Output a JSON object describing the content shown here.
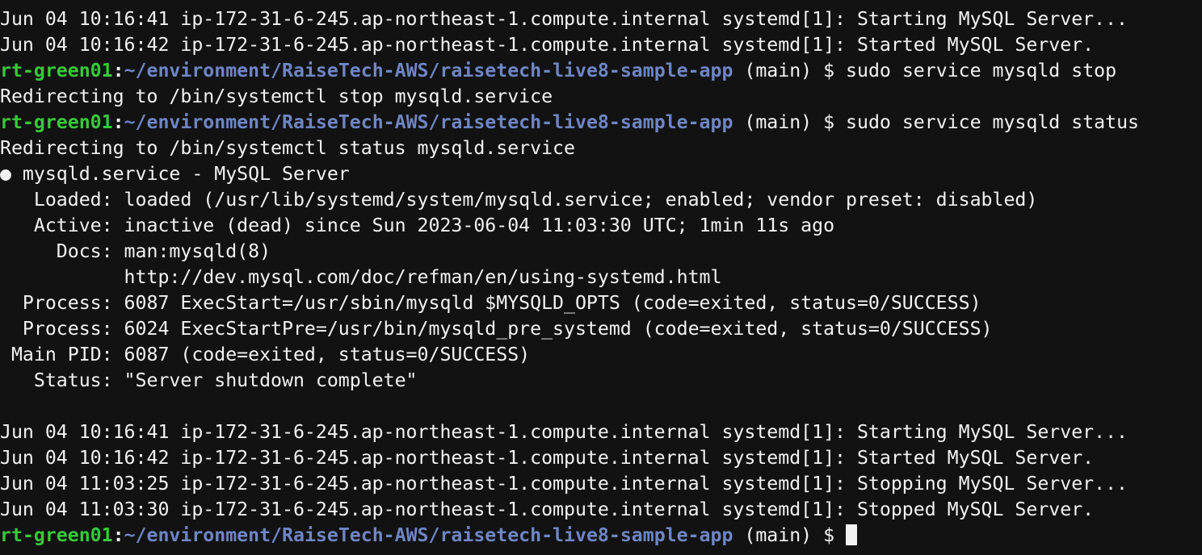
{
  "terminal": {
    "prompt": {
      "user": "rt-green01",
      "colon": ":",
      "path": "~/environment/RaiseTech-AWS/raisetech-live8-sample-app",
      "suffix": " (main) $ "
    },
    "lines": [
      {
        "type": "text",
        "text": "Jun 04 10:16:41 ip-172-31-6-245.ap-northeast-1.compute.internal systemd[1]: Starting MySQL Server..."
      },
      {
        "type": "text",
        "text": "Jun 04 10:16:42 ip-172-31-6-245.ap-northeast-1.compute.internal systemd[1]: Started MySQL Server."
      },
      {
        "type": "prompt",
        "command": "sudo service mysqld stop"
      },
      {
        "type": "text",
        "text": "Redirecting to /bin/systemctl stop mysqld.service"
      },
      {
        "type": "prompt",
        "command": "sudo service mysqld status"
      },
      {
        "type": "text",
        "text": "Redirecting to /bin/systemctl status mysqld.service"
      },
      {
        "type": "text",
        "text": "● mysqld.service - MySQL Server"
      },
      {
        "type": "text",
        "text": "   Loaded: loaded (/usr/lib/systemd/system/mysqld.service; enabled; vendor preset: disabled)"
      },
      {
        "type": "text",
        "text": "   Active: inactive (dead) since Sun 2023-06-04 11:03:30 UTC; 1min 11s ago"
      },
      {
        "type": "text",
        "text": "     Docs: man:mysqld(8)"
      },
      {
        "type": "text",
        "text": "           http://dev.mysql.com/doc/refman/en/using-systemd.html"
      },
      {
        "type": "text",
        "text": "  Process: 6087 ExecStart=/usr/sbin/mysqld $MYSQLD_OPTS (code=exited, status=0/SUCCESS)"
      },
      {
        "type": "text",
        "text": "  Process: 6024 ExecStartPre=/usr/bin/mysqld_pre_systemd (code=exited, status=0/SUCCESS)"
      },
      {
        "type": "text",
        "text": " Main PID: 6087 (code=exited, status=0/SUCCESS)"
      },
      {
        "type": "text",
        "text": "   Status: \"Server shutdown complete\""
      },
      {
        "type": "text",
        "text": ""
      },
      {
        "type": "text",
        "text": "Jun 04 10:16:41 ip-172-31-6-245.ap-northeast-1.compute.internal systemd[1]: Starting MySQL Server..."
      },
      {
        "type": "text",
        "text": "Jun 04 10:16:42 ip-172-31-6-245.ap-northeast-1.compute.internal systemd[1]: Started MySQL Server."
      },
      {
        "type": "text",
        "text": "Jun 04 11:03:25 ip-172-31-6-245.ap-northeast-1.compute.internal systemd[1]: Stopping MySQL Server..."
      },
      {
        "type": "text",
        "text": "Jun 04 11:03:30 ip-172-31-6-245.ap-northeast-1.compute.internal systemd[1]: Stopped MySQL Server."
      },
      {
        "type": "prompt",
        "command": "",
        "cursor": true
      }
    ]
  },
  "colors": {
    "background": "#121212",
    "foreground": "#f2f2f2",
    "user": "#37c93a",
    "path": "#6f86c4"
  }
}
